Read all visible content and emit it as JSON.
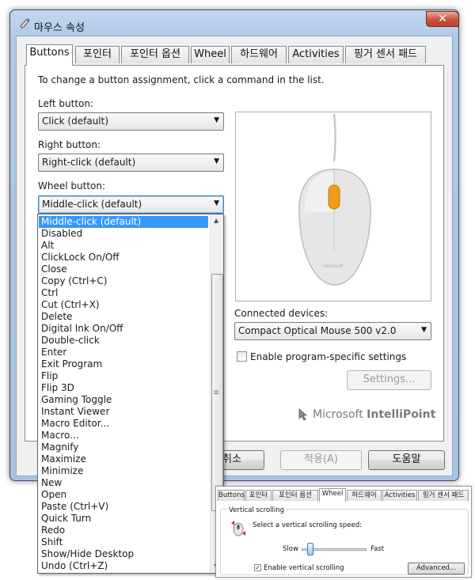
{
  "window": {
    "title": "마우스 속성",
    "close_glyph": "✕"
  },
  "tabs": [
    "Buttons",
    "포인터",
    "포인터 옵션",
    "Wheel",
    "하드웨어",
    "Activities",
    "핑거 센서 패드"
  ],
  "buttons_tab": {
    "instruction": "To change a button assignment, click a command in the list.",
    "left_label": "Left button:",
    "left_value": "Click (default)",
    "right_label": "Right button:",
    "right_value": "Right-click (default)",
    "wheel_label": "Wheel button:",
    "wheel_value": "Middle-click (default)",
    "connected_label": "Connected devices:",
    "connected_value": "Compact Optical Mouse 500 v2.0",
    "program_specific_label": "Enable program-specific settings",
    "program_specific_checked": false,
    "settings_button": "Settings...",
    "brand_microsoft": "Microsoft",
    "brand_intellipoint": "IntelliPoint",
    "accent_color": "#f39a1e"
  },
  "footer": {
    "cancel": "취소",
    "apply": "적용(A)",
    "help": "도움말"
  },
  "dropdown_items": [
    "Middle-click (default)",
    "Disabled",
    "Alt",
    "ClickLock On/Off",
    "Close",
    "Copy (Ctrl+C)",
    "Ctrl",
    "Cut (Ctrl+X)",
    "Delete",
    "Digital Ink On/Off",
    "Double-click",
    "Enter",
    "Exit Program",
    "Flip",
    "Flip 3D",
    "Gaming Toggle",
    "Instant Viewer",
    "Macro Editor...",
    "Macro...",
    "Magnify",
    "Maximize",
    "Minimize",
    "New",
    "Open",
    "Paste (Ctrl+V)",
    "Quick Turn",
    "Redo",
    "Shift",
    "Show/Hide Desktop",
    "Undo (Ctrl+Z)"
  ],
  "dropdown_selected": "Middle-click (default)",
  "inset": {
    "tabs": [
      "Buttons",
      "포인터",
      "포인터 옵션",
      "Wheel",
      "하드웨어",
      "Activities",
      "핑거 센서 패드"
    ],
    "group_title": "Vertical scrolling",
    "speed_label": "Select a vertical scrolling speed:",
    "slow": "Slow",
    "fast": "Fast",
    "enable_label": "Enable vertical scrolling",
    "enable_checked": true,
    "advanced_button": "Advanced...",
    "speed_fraction": 0.1
  }
}
